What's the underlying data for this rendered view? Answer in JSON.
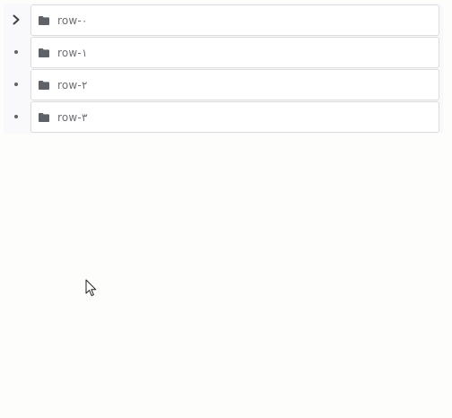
{
  "tree": {
    "rows": [
      {
        "label": "row-٠",
        "toggle_icon": "chevron-right-icon",
        "item_icon": "folder-icon"
      },
      {
        "label": "row-١",
        "toggle_icon": "bullet-icon",
        "item_icon": "folder-icon"
      },
      {
        "label": "row-٢",
        "toggle_icon": "bullet-icon",
        "item_icon": "folder-icon"
      },
      {
        "label": "row-٣",
        "toggle_icon": "bullet-icon",
        "item_icon": "folder-icon"
      }
    ]
  },
  "colors": {
    "background": "#fdfdfb",
    "row_border": "#dcdcdf",
    "icon": "#5f6368",
    "label_text": "#6e6e73"
  },
  "cursor_icon": "mouse-pointer-icon"
}
